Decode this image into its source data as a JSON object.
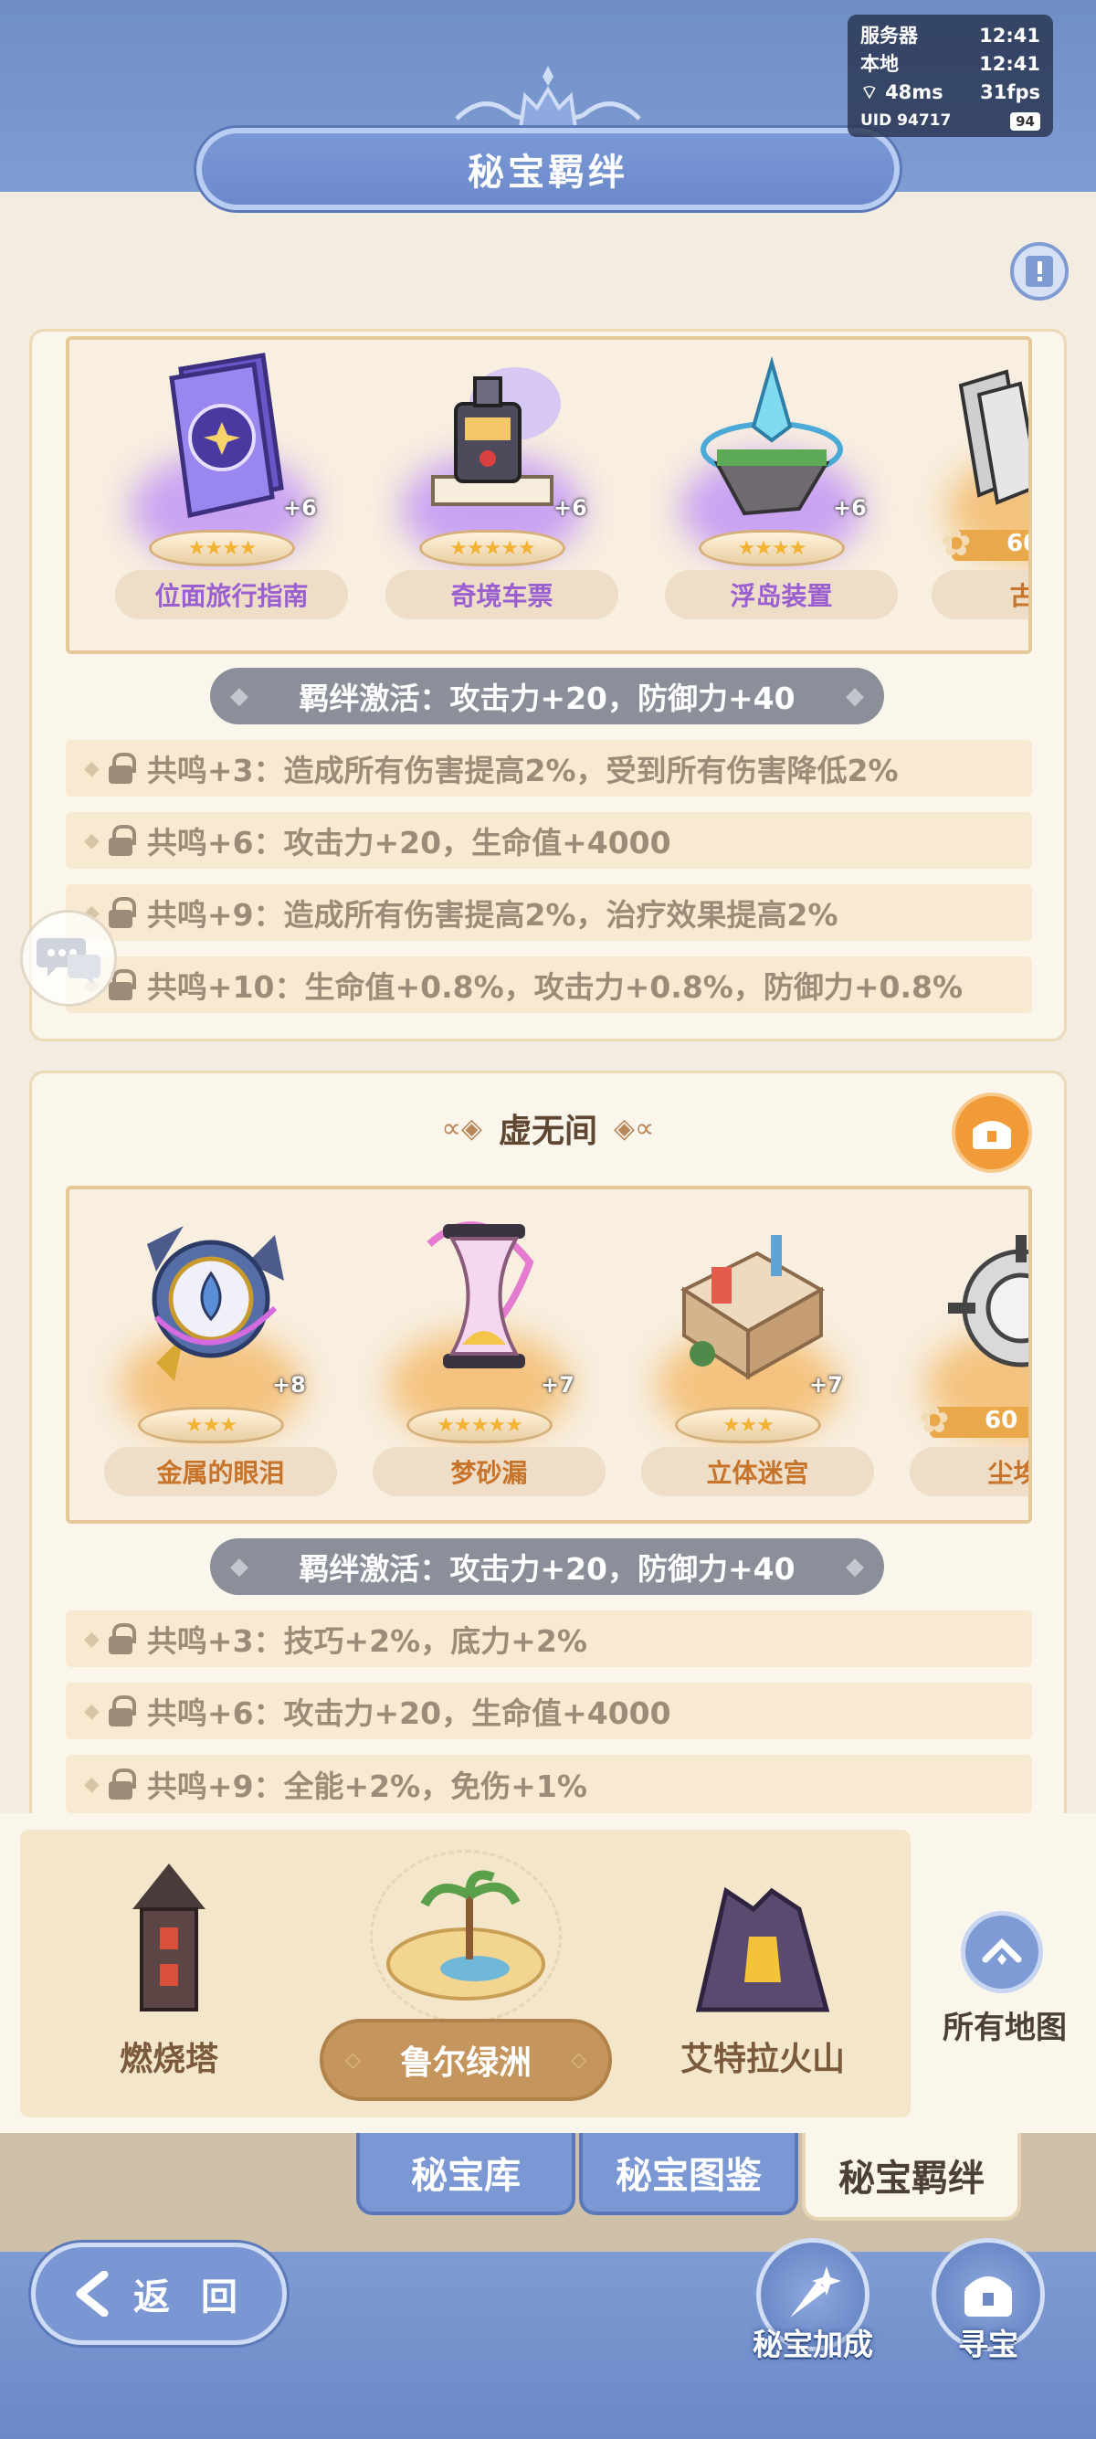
{
  "header": {
    "title": "秘宝羁绊"
  },
  "status": {
    "server_label": "服务器",
    "server_time": "12:41",
    "local_label": "本地",
    "local_time": "12:41",
    "ping": "48ms",
    "fps": "31fps",
    "uid": "UID 94717",
    "battery": "94"
  },
  "section1": {
    "treasures": [
      {
        "name": "位面旅行指南",
        "plus": "+6",
        "stars": 4,
        "icon": "book-icon"
      },
      {
        "name": "奇境车票",
        "plus": "+6",
        "stars": 5,
        "icon": "train-ticket-icon"
      },
      {
        "name": "浮岛装置",
        "plus": "+6",
        "stars": 4,
        "icon": "floating-island-icon"
      },
      {
        "name": "古老大",
        "progress": "60",
        "icon": "ancient-relic-icon"
      }
    ],
    "bond": "羁绊激活：攻击力+20，防御力+40",
    "resonances": [
      "共鸣+3：造成所有伤害提高2%，受到所有伤害降低2%",
      "共鸣+6：攻击力+20，生命值+4000",
      "共鸣+9：造成所有伤害提高2%，治疗效果提高2%",
      "共鸣+10：生命值+0.8%，攻击力+0.8%，防御力+0.8%"
    ]
  },
  "section2": {
    "title": "虚无间",
    "treasures": [
      {
        "name": "金属的眼泪",
        "plus": "+8",
        "stars": 3,
        "icon": "metal-tear-icon"
      },
      {
        "name": "梦砂漏",
        "plus": "+7",
        "stars": 5,
        "icon": "hourglass-icon"
      },
      {
        "name": "立体迷宫",
        "plus": "+7",
        "stars": 3,
        "icon": "maze-icon"
      },
      {
        "name": "尘埃的",
        "progress": "60",
        "icon": "gear-relic-icon"
      }
    ],
    "bond": "羁绊激活：攻击力+20，防御力+40",
    "resonances": [
      "共鸣+3：技巧+2%，底力+2%",
      "共鸣+6：攻击力+20，生命值+4000",
      "共鸣+9：全能+2%，免伤+1%"
    ]
  },
  "maps": {
    "items": [
      "燃烧塔",
      "鲁尔绿洲",
      "艾特拉火山"
    ],
    "selected": "鲁尔绿洲",
    "all_maps": "所有地图"
  },
  "tabs": [
    "秘宝库",
    "秘宝图鉴",
    "秘宝羁绊"
  ],
  "footer": {
    "back": "返 回",
    "enhance": "秘宝加成",
    "treasure_hunt": "寻宝"
  },
  "colors": {
    "primary_blue": "#7c98d4",
    "panel_bg": "#fbf6ec",
    "gold": "#c4965e",
    "purple_text": "#9a5fd0",
    "orange_text": "#c8732a"
  }
}
